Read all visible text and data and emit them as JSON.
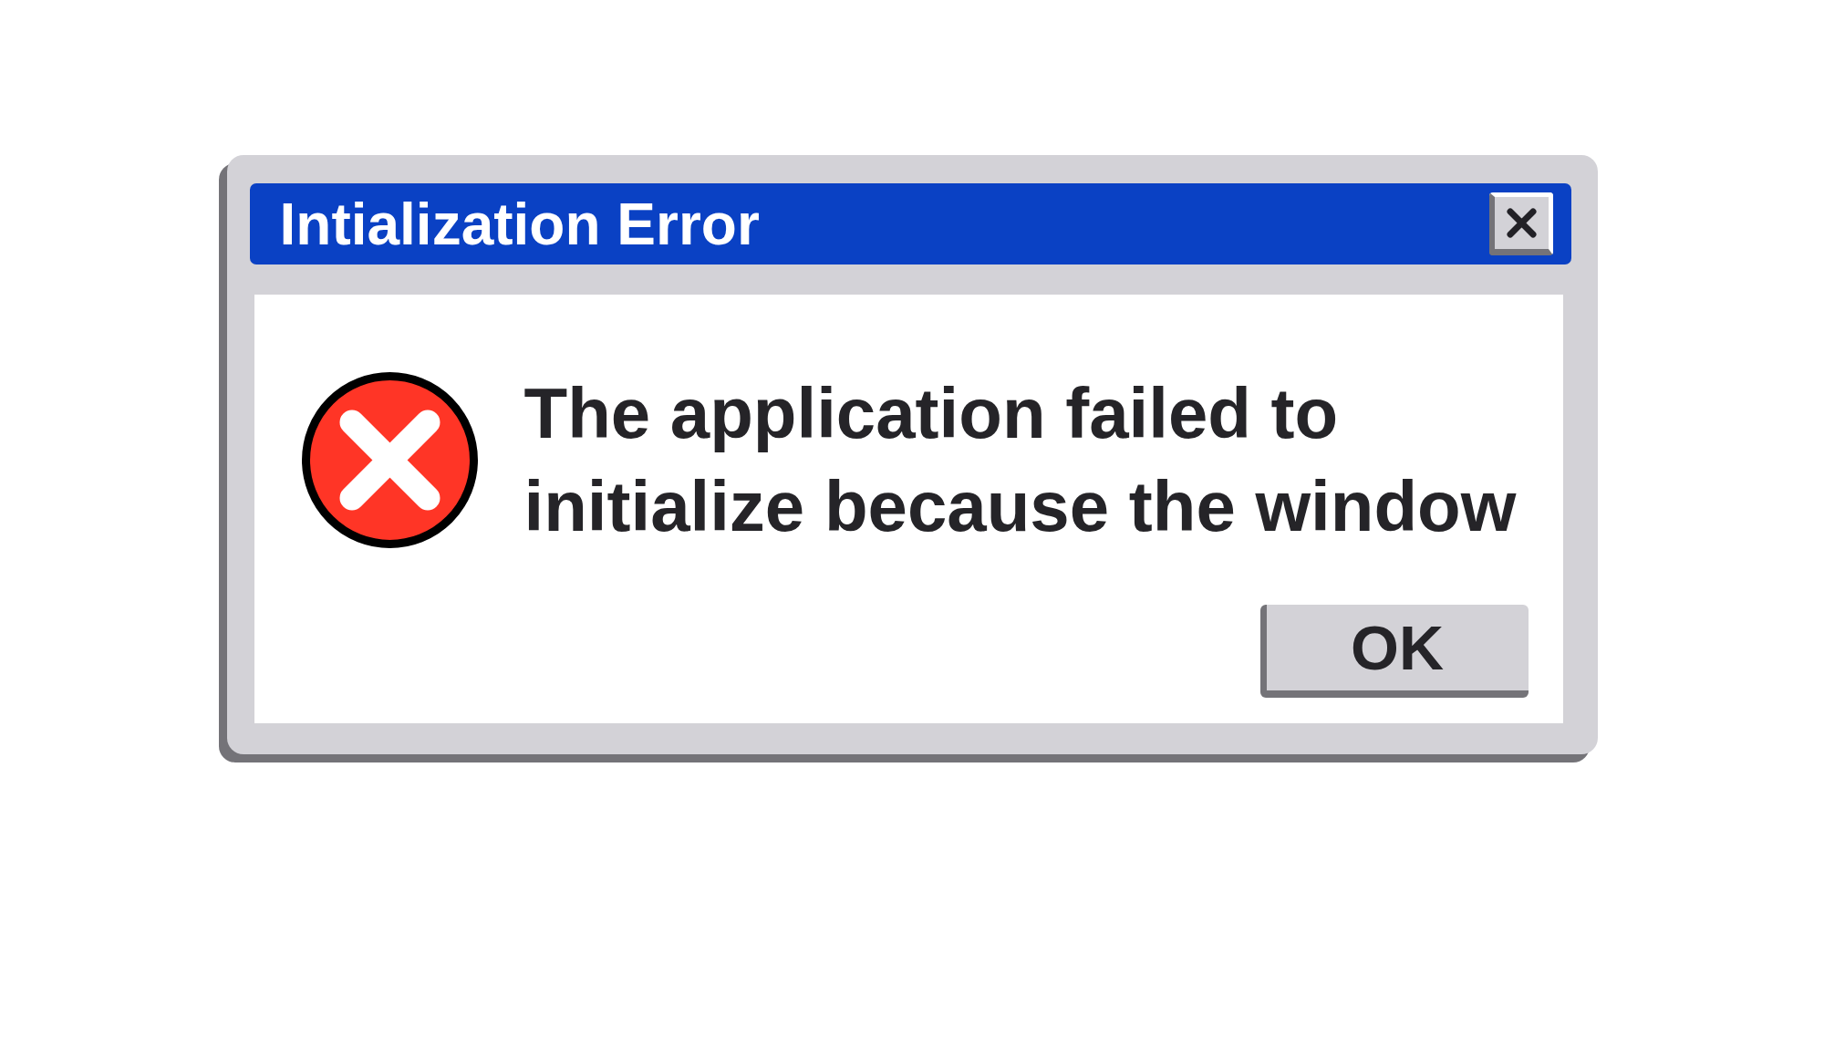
{
  "window": {
    "title": "Intialization Error"
  },
  "message": "The application failed to initialize because the window",
  "buttons": [
    "OK"
  ]
}
